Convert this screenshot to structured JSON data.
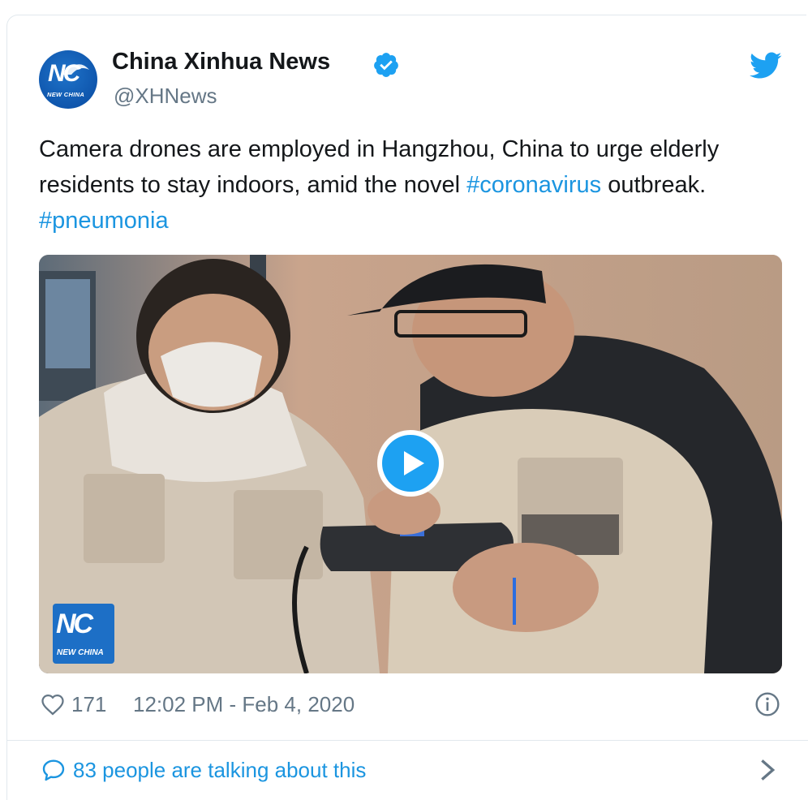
{
  "tweet": {
    "author": {
      "name": "China Xinhua News",
      "handle": "@XHNews",
      "avatar_logo": "NC",
      "avatar_sub": "NEW CHINA",
      "verified_icon": "verified-badge-icon"
    },
    "brand_icon": "twitter-bird-icon",
    "text": {
      "part1": "Camera drones are employed in Hangzhou, China to urge elderly residents to stay indoors, amid the novel ",
      "hashtag1": "#coronavirus",
      "part2": " outbreak. ",
      "hashtag2": "#pneumonia"
    },
    "media": {
      "type": "video",
      "play_icon": "play-icon",
      "overlay_logo": "NC",
      "overlay_logo_sub": "NEW CHINA"
    },
    "footer": {
      "likes": "171",
      "timestamp": "12:02 PM - Feb 4, 2020",
      "info_icon": "info-icon"
    },
    "conversation": {
      "label": "83 people are talking about this",
      "icon": "speech-bubble-icon",
      "chevron": "chevron-right-icon"
    }
  },
  "colors": {
    "accent": "#1da1f2",
    "link": "#1b95e0",
    "text": "#14171a",
    "muted": "#657786",
    "border": "#e1e8ed"
  }
}
